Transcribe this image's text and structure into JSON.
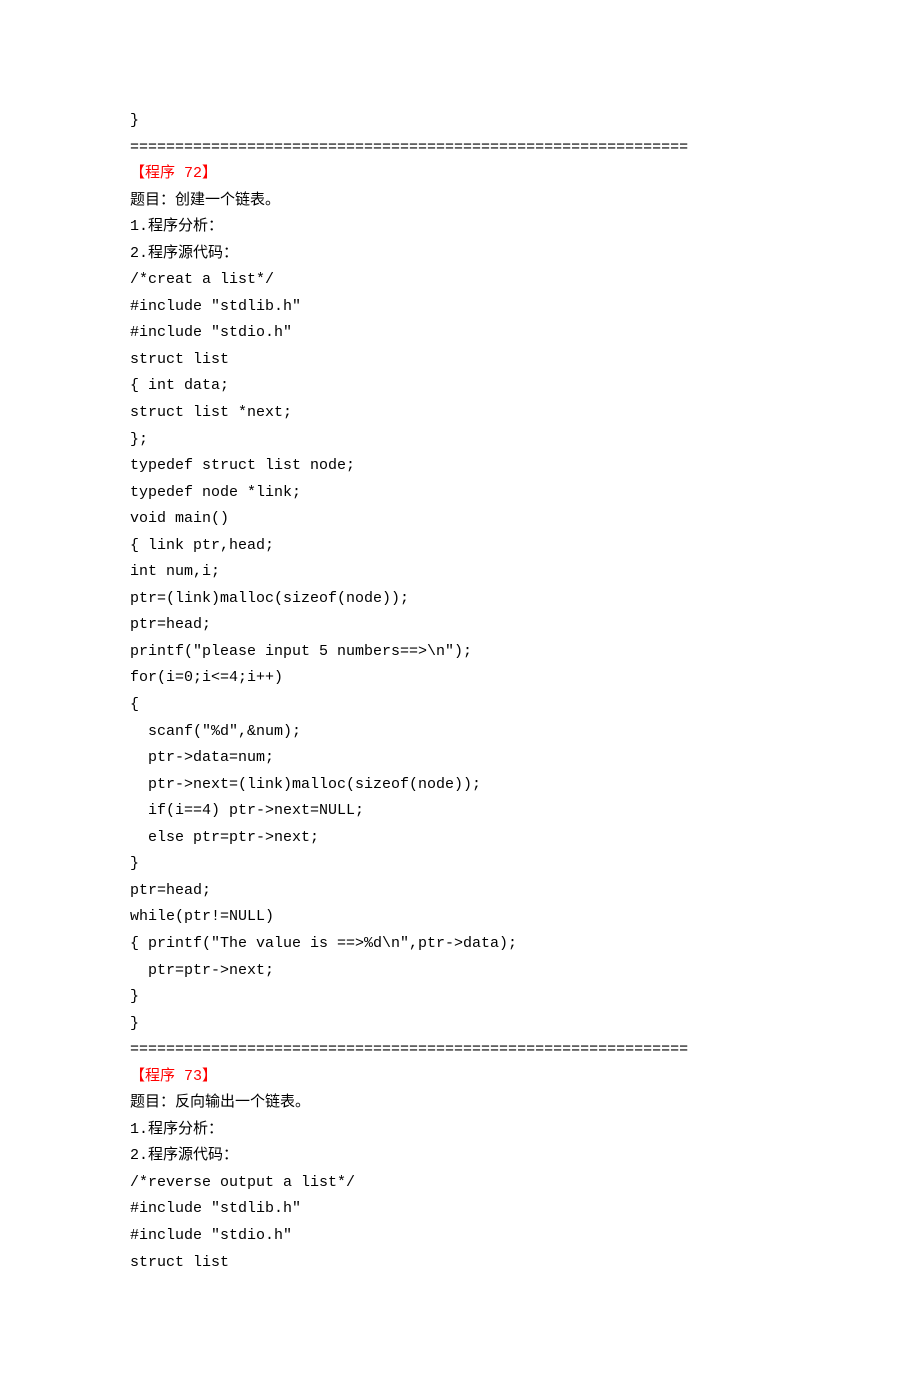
{
  "lines": [
    {
      "text": "}",
      "red": false,
      "indent": false
    },
    {
      "text": "==============================================================",
      "red": false,
      "indent": false,
      "divider": true
    },
    {
      "text": "【程序 72】",
      "red": true,
      "indent": false
    },
    {
      "text": "题目：创建一个链表。",
      "red": false,
      "indent": false
    },
    {
      "text": "1.程序分析：",
      "red": false,
      "indent": false
    },
    {
      "text": "2.程序源代码：",
      "red": false,
      "indent": false
    },
    {
      "text": "/*creat a list*/",
      "red": false,
      "indent": false
    },
    {
      "text": "#include \"stdlib.h\"",
      "red": false,
      "indent": false
    },
    {
      "text": "#include \"stdio.h\"",
      "red": false,
      "indent": false
    },
    {
      "text": "struct list",
      "red": false,
      "indent": false
    },
    {
      "text": "{ int data;",
      "red": false,
      "indent": false
    },
    {
      "text": "struct list *next;",
      "red": false,
      "indent": false
    },
    {
      "text": "};",
      "red": false,
      "indent": false
    },
    {
      "text": "typedef struct list node;",
      "red": false,
      "indent": false
    },
    {
      "text": "typedef node *link;",
      "red": false,
      "indent": false
    },
    {
      "text": "void main()",
      "red": false,
      "indent": false
    },
    {
      "text": "{ link ptr,head;",
      "red": false,
      "indent": false
    },
    {
      "text": "int num,i;",
      "red": false,
      "indent": false
    },
    {
      "text": "ptr=(link)malloc(sizeof(node));",
      "red": false,
      "indent": false
    },
    {
      "text": "ptr=head;",
      "red": false,
      "indent": false
    },
    {
      "text": "printf(\"please input 5 numbers==>\\n\");",
      "red": false,
      "indent": false
    },
    {
      "text": "for(i=0;i<=4;i++)",
      "red": false,
      "indent": false
    },
    {
      "text": "{",
      "red": false,
      "indent": false
    },
    {
      "text": "scanf(\"%d\",&num);",
      "red": false,
      "indent": true
    },
    {
      "text": "ptr->data=num;",
      "red": false,
      "indent": true
    },
    {
      "text": "ptr->next=(link)malloc(sizeof(node));",
      "red": false,
      "indent": true
    },
    {
      "text": "if(i==4) ptr->next=NULL;",
      "red": false,
      "indent": true
    },
    {
      "text": "else ptr=ptr->next;",
      "red": false,
      "indent": true
    },
    {
      "text": "}",
      "red": false,
      "indent": false
    },
    {
      "text": "ptr=head;",
      "red": false,
      "indent": false
    },
    {
      "text": "while(ptr!=NULL)",
      "red": false,
      "indent": false
    },
    {
      "text": "{ printf(\"The value is ==>%d\\n\",ptr->data);",
      "red": false,
      "indent": false
    },
    {
      "text": "ptr=ptr->next;",
      "red": false,
      "indent": true
    },
    {
      "text": "}",
      "red": false,
      "indent": false
    },
    {
      "text": "}",
      "red": false,
      "indent": false
    },
    {
      "text": "==============================================================",
      "red": false,
      "indent": false,
      "divider": true
    },
    {
      "text": "【程序 73】",
      "red": true,
      "indent": false
    },
    {
      "text": "题目：反向输出一个链表。",
      "red": false,
      "indent": false
    },
    {
      "text": "1.程序分析：",
      "red": false,
      "indent": false
    },
    {
      "text": "2.程序源代码：",
      "red": false,
      "indent": false
    },
    {
      "text": "/*reverse output a list*/",
      "red": false,
      "indent": false
    },
    {
      "text": "#include \"stdlib.h\"",
      "red": false,
      "indent": false
    },
    {
      "text": "#include \"stdio.h\"",
      "red": false,
      "indent": false
    },
    {
      "text": "struct list",
      "red": false,
      "indent": false
    }
  ]
}
